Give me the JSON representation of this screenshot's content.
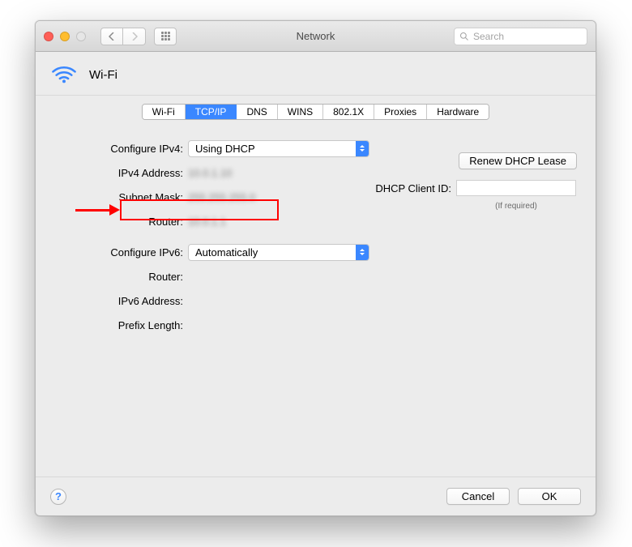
{
  "window": {
    "title": "Network"
  },
  "search": {
    "placeholder": "Search"
  },
  "wifi": {
    "title": "Wi-Fi"
  },
  "tabs": {
    "items": [
      "Wi-Fi",
      "TCP/IP",
      "DNS",
      "WINS",
      "802.1X",
      "Proxies",
      "Hardware"
    ],
    "active_index": 1
  },
  "form": {
    "configure_ipv4_label": "Configure IPv4:",
    "configure_ipv4_value": "Using DHCP",
    "ipv4_address_label": "IPv4 Address:",
    "ipv4_address_value": "10.0.1.10",
    "subnet_mask_label": "Subnet Mask:",
    "subnet_mask_value": "255.255.255.0",
    "router_label": "Router:",
    "router_value": "10.0.1.1",
    "configure_ipv6_label": "Configure IPv6:",
    "configure_ipv6_value": "Automatically",
    "router6_label": "Router:",
    "ipv6_address_label": "IPv6 Address:",
    "prefix_length_label": "Prefix Length:"
  },
  "right": {
    "renew_label": "Renew DHCP Lease",
    "dhcp_client_id_label": "DHCP Client ID:",
    "dhcp_client_id_value": "",
    "if_required": "(If required)"
  },
  "footer": {
    "help": "?",
    "cancel": "Cancel",
    "ok": "OK"
  }
}
